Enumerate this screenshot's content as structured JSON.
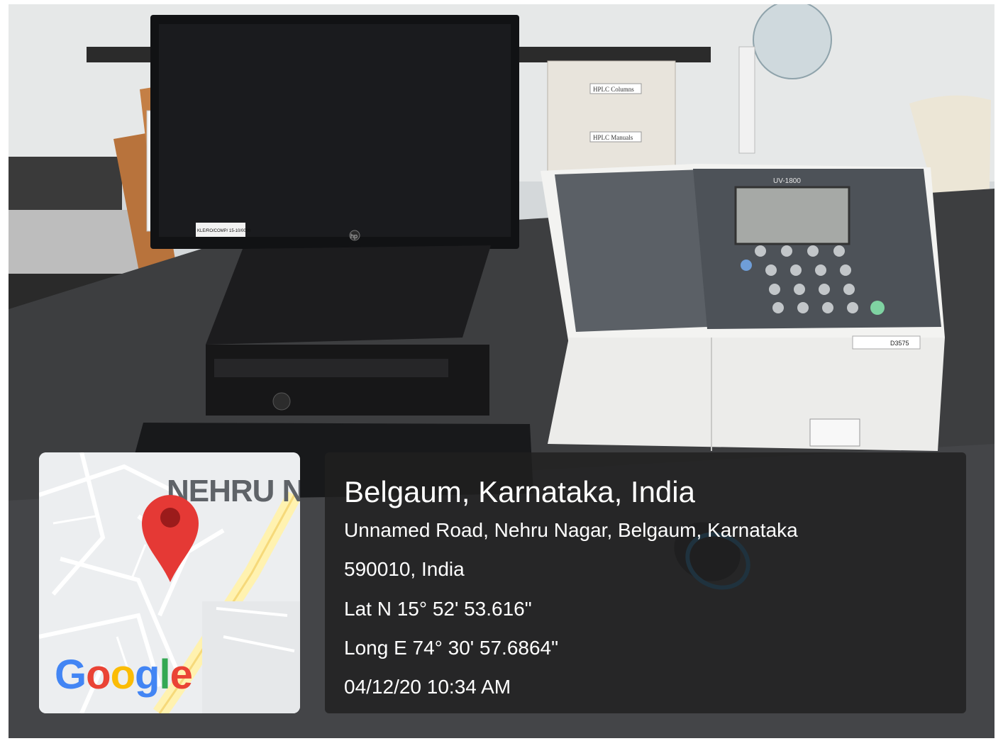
{
  "location_title": "Belgaum, Karnataka, India",
  "address_line1": "Unnamed Road, Nehru Nagar, Belgaum, Karnataka",
  "address_line2": "590010, India",
  "latitude": "Lat N 15° 52' 53.616\"",
  "longitude": "Long E 74° 30' 57.6864\"",
  "datetime": "04/12/20 10:34 AM",
  "map": {
    "area_label": "NEHRU N",
    "logo_letters": [
      "G",
      "o",
      "o",
      "g",
      "l",
      "e"
    ],
    "logo_colors": [
      "#4285F4",
      "#EA4335",
      "#FBBC05",
      "#4285F4",
      "#34A853",
      "#EA4335"
    ],
    "marker_color": "#E53935",
    "marker_icon": "map-pin-icon"
  },
  "photo": {
    "equipment_model": "UV-1800",
    "serial_label": "D3575",
    "shelf_label_1": "HPLC Columns",
    "shelf_label_2": "HPLC Manuals",
    "monitor_tag": "KLE/RO/COMP/ 15-10/0098",
    "brand_mark": "hp"
  }
}
